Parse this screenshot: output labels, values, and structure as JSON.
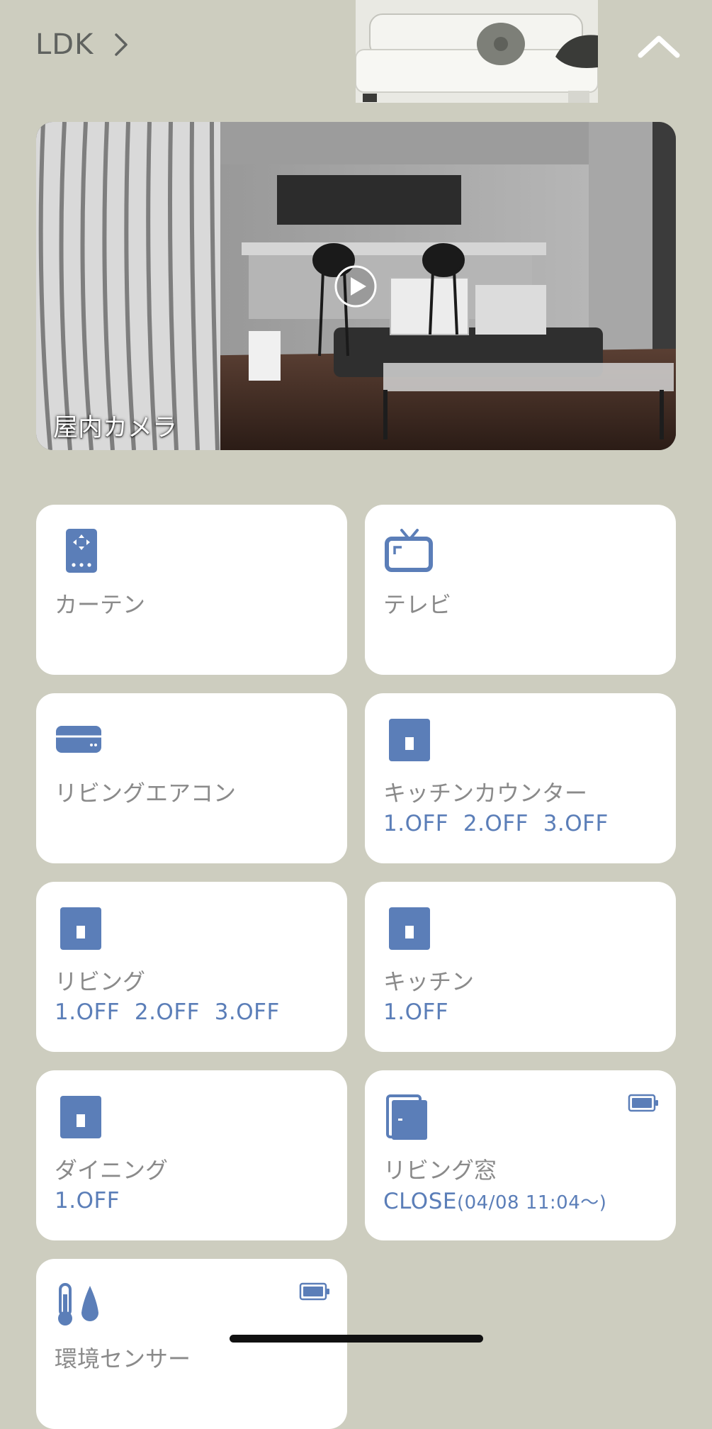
{
  "header": {
    "room_name": "LDK"
  },
  "camera": {
    "label": "屋内カメラ"
  },
  "devices": [
    {
      "title": "カーテン",
      "status": "",
      "icon": "remote-control-icon"
    },
    {
      "title": "テレビ",
      "status": "",
      "icon": "tv-icon"
    },
    {
      "title": "リビングエアコン",
      "status": "",
      "icon": "air-conditioner-icon"
    },
    {
      "title": "キッチンカウンター",
      "status": "1.OFF  2.OFF  3.OFF",
      "icon": "wall-switch-icon"
    },
    {
      "title": "リビング",
      "status": "1.OFF  2.OFF  3.OFF",
      "icon": "wall-switch-icon"
    },
    {
      "title": "キッチン",
      "status": "1.OFF",
      "icon": "wall-switch-icon"
    },
    {
      "title": "ダイニング",
      "status": "1.OFF",
      "icon": "wall-switch-icon"
    },
    {
      "title": "リビング窓",
      "status": "CLOSE",
      "status_detail": "(04/08 11:04〜)",
      "icon": "window-sensor-icon",
      "battery": "battery-icon"
    },
    {
      "title": "環境センサー",
      "status": "",
      "icon": "thermometer-drop-icon",
      "battery": "battery-icon"
    }
  ],
  "colors": {
    "background": "#cdcdbf",
    "card": "#ffffff",
    "accent": "#5b7eb8",
    "title_text": "#8a8a8a"
  }
}
